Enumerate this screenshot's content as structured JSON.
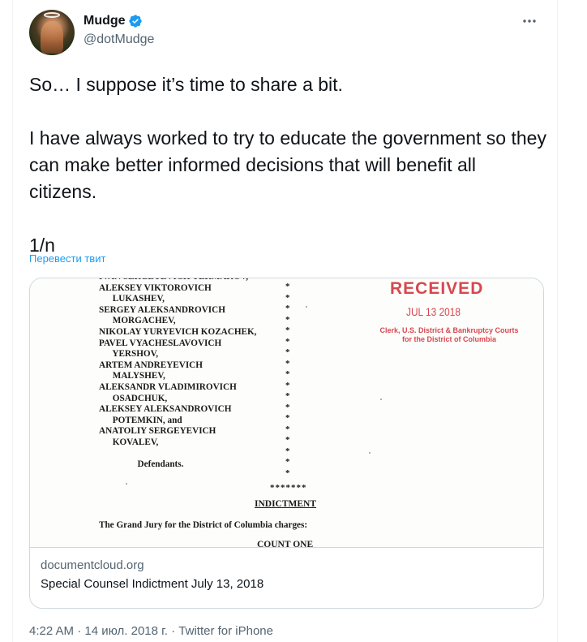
{
  "author": {
    "name": "Mudge",
    "handle": "@dotMudge",
    "verified": true,
    "avatar_icon": "profile-photo"
  },
  "more_icon": "ellipsis-icon",
  "tweet": {
    "text": "So… I suppose it’s time to share a bit.\n\nI have always worked to try to educate the government so they can make better informed decisions that will benefit all citizens.\n\n1/n",
    "translate_label": "Перевести твит"
  },
  "card": {
    "document": {
      "defendants_block": "IVAN SERGEYEVICH YERMAKOV,\nALEKSEY VIKTOROVICH\n      LUKASHEV,\nSERGEY ALEKSANDROVICH\n      MORGACHEV,\nNIKOLAY YURYEVICH KOZACHEK,\nPAVEL VYACHESLAVOVICH\n      YERSHOV,\nARTEM ANDREYEVICH\n      MALYSHEV,\nALEKSANDR VLADIMIROVICH\n      OSADCHUK,\nALEKSEY ALEKSANDROVICH\n      POTEMKIN, and\nANATOLIY SERGEYEVICH\n      KOVALEV,\n\n                 Defendants.",
      "stars_column": "*\n*\n*\n*\n*\n*\n*\n*\n*\n*\n*\n*\n*\n*\n*\n*\n*\n*",
      "separator": "*******",
      "heading": "INDICTMENT",
      "charges_line": "The Grand Jury for the District of Columbia charges:",
      "count_heading": "COUNT ONE",
      "stamp": {
        "received": "RECEIVED",
        "date": "JUL 13 2018",
        "clerk": "Clerk, U.S. District & Bankruptcy Courts for the District of Columbia",
        "color": "#d8474f"
      }
    },
    "domain": "documentcloud.org",
    "title": "Special Counsel Indictment July 13, 2018"
  },
  "footer": {
    "meta": "4:22 AM · 14 июл. 2018 г. · Twitter for iPhone"
  },
  "colors": {
    "accent": "#1d9bf0",
    "secondary_text": "#536471",
    "border": "#cfd9de"
  }
}
